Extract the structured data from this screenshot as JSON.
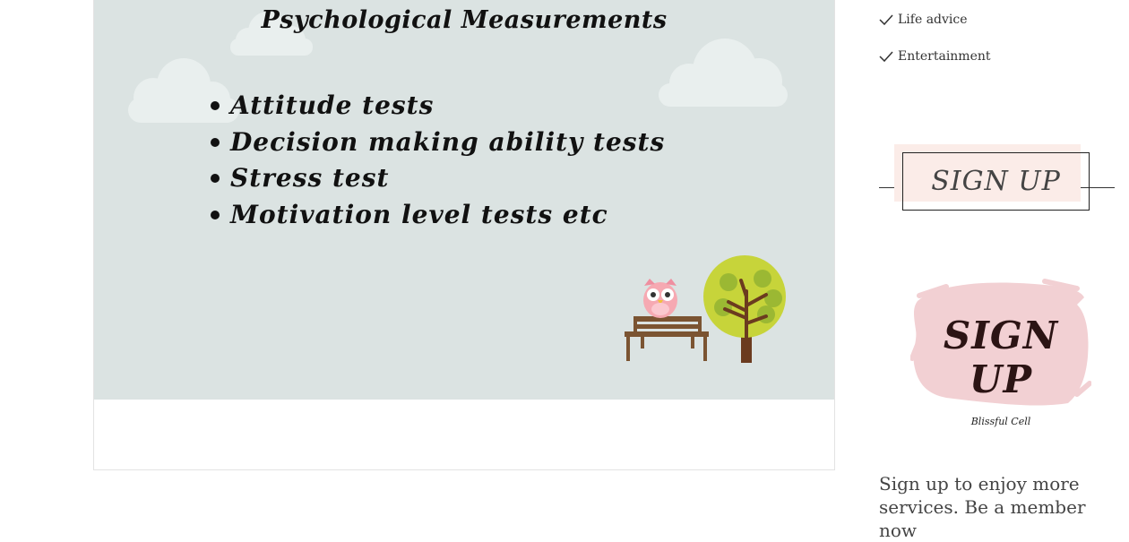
{
  "slide": {
    "title": "Psychological Measurements",
    "bullets": [
      "Attitude tests",
      "Decision making ability tests",
      "Stress test",
      "Motivation level tests etc"
    ],
    "background_color": "#dbe3e2"
  },
  "sidebar": {
    "checklist": [
      {
        "label": "Life advice",
        "icon": "check-icon"
      },
      {
        "label": "Entertainment",
        "icon": "check-icon"
      }
    ],
    "signup_button_label": "SIGN UP",
    "logo": {
      "text": "SIGN UP",
      "caption": "Blissful Cell",
      "brush_color": "#f2d0d3"
    },
    "promo_text": "Sign up to enjoy more services. Be a member now"
  }
}
